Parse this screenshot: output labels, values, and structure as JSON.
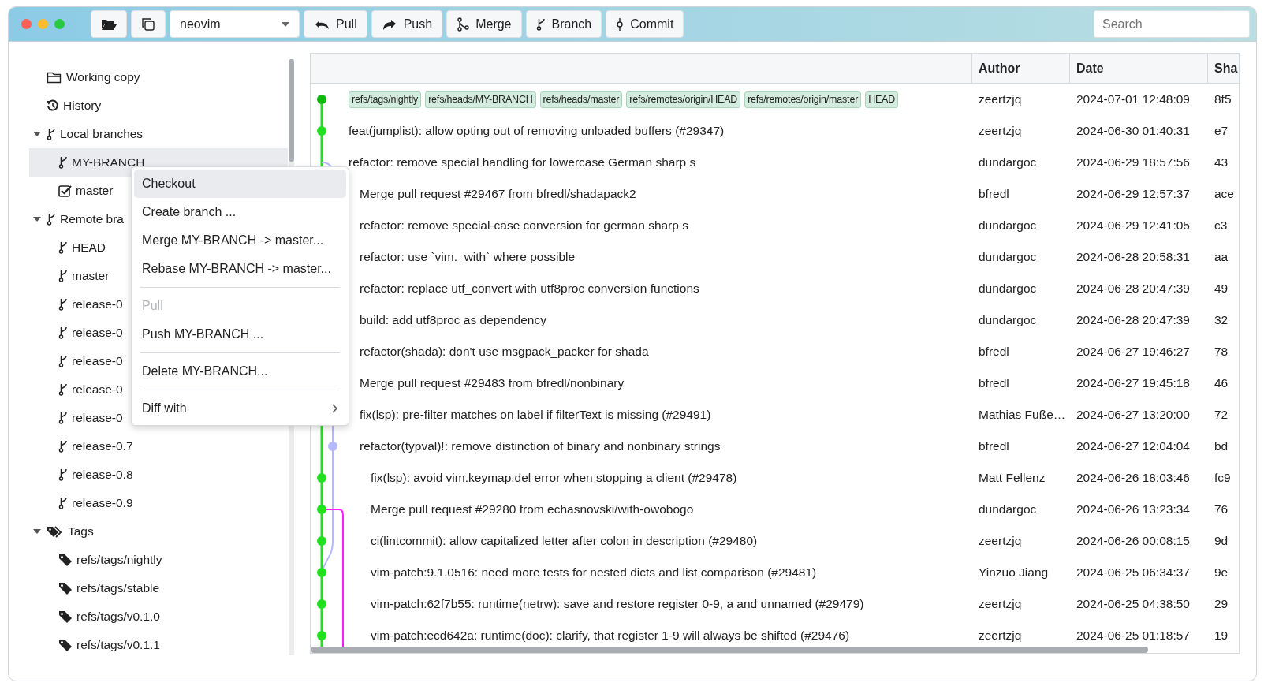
{
  "toolbar": {
    "repository": "neovim",
    "buttons": [
      {
        "label": "Pull",
        "kind": "pull"
      },
      {
        "label": "Push",
        "kind": "push"
      },
      {
        "label": "Merge",
        "kind": "merge"
      },
      {
        "label": "Branch",
        "kind": "branch"
      },
      {
        "label": "Commit",
        "kind": "commit"
      }
    ],
    "search": {
      "placeholder": "Search"
    }
  },
  "sidebar": {
    "items": [
      {
        "label": "Working copy",
        "kind": "working-copy",
        "selected": false
      },
      {
        "label": "History",
        "kind": "history",
        "selected": false
      },
      {
        "label": "Local branches",
        "kind": "branch-group",
        "expanded": true,
        "selected": false,
        "children": [
          {
            "label": "MY-BRANCH",
            "kind": "branch",
            "selected": true
          },
          {
            "label": "master",
            "kind": "current-branch",
            "selected": false
          }
        ]
      },
      {
        "label": "Remote bra",
        "kind": "branch-group",
        "expanded": true,
        "selected": false,
        "children": [
          {
            "label": "HEAD",
            "kind": "branch",
            "selected": false
          },
          {
            "label": "master",
            "kind": "branch",
            "selected": false
          },
          {
            "label": "release-0",
            "kind": "branch",
            "selected": false
          },
          {
            "label": "release-0",
            "kind": "branch",
            "selected": false
          },
          {
            "label": "release-0",
            "kind": "branch",
            "selected": false
          },
          {
            "label": "release-0",
            "kind": "branch",
            "selected": false
          },
          {
            "label": "release-0",
            "kind": "branch",
            "selected": false
          },
          {
            "label": "release-0.7",
            "kind": "branch",
            "selected": false
          },
          {
            "label": "release-0.8",
            "kind": "branch",
            "selected": false
          },
          {
            "label": "release-0.9",
            "kind": "branch",
            "selected": false
          }
        ]
      },
      {
        "label": "Tags",
        "kind": "tag-group",
        "expanded": true,
        "selected": false,
        "children": [
          {
            "label": "refs/tags/nightly",
            "kind": "tag",
            "selected": false
          },
          {
            "label": "refs/tags/stable",
            "kind": "tag",
            "selected": false
          },
          {
            "label": "refs/tags/v0.1.0",
            "kind": "tag",
            "selected": false
          },
          {
            "label": "refs/tags/v0.1.1",
            "kind": "tag",
            "selected": false
          }
        ]
      }
    ]
  },
  "context_menu": {
    "items": [
      {
        "kind": "item",
        "label": "Checkout",
        "selected": true,
        "disabled": false
      },
      {
        "kind": "item",
        "label": "Create branch ...",
        "selected": false,
        "disabled": false
      },
      {
        "kind": "item",
        "label": "Merge MY-BRANCH -> master...",
        "selected": false,
        "disabled": false
      },
      {
        "kind": "item",
        "label": "Rebase MY-BRANCH -> master...",
        "selected": false,
        "disabled": false
      },
      {
        "kind": "separator"
      },
      {
        "kind": "item",
        "label": "Pull",
        "selected": false,
        "disabled": true
      },
      {
        "kind": "item",
        "label": "Push MY-BRANCH ...",
        "selected": false,
        "disabled": false
      },
      {
        "kind": "separator"
      },
      {
        "kind": "item",
        "label": "Delete MY-BRANCH...",
        "selected": false,
        "disabled": false
      },
      {
        "kind": "separator"
      },
      {
        "kind": "submenu",
        "label": "Diff with",
        "selected": false,
        "disabled": false
      }
    ]
  },
  "commits": {
    "columns": [
      "Author",
      "Date",
      "Sha"
    ],
    "rows": [
      {
        "refs": [
          "refs/tags/nightly",
          "refs/heads/MY-BRANCH",
          "refs/heads/master",
          "refs/remotes/origin/HEAD",
          "refs/remotes/origin/master",
          "HEAD"
        ],
        "author": "zeertzjq",
        "date": "2024-07-01 12:48:09",
        "sha": "8f5"
      },
      {
        "message": "feat(jumplist): allow opting out of removing unloaded buffers (#29347)",
        "author": "zeertzjq",
        "date": "2024-06-30 01:40:31",
        "sha": "e7"
      },
      {
        "message": "refactor: remove special handling for lowercase German sharp s",
        "author": "dundargoc",
        "date": "2024-06-29 18:57:56",
        "sha": "43"
      },
      {
        "message": "Merge pull request #29467 from bfredl/shadapack2",
        "author": "bfredl",
        "date": "2024-06-29 12:57:37",
        "sha": "ace"
      },
      {
        "message": "refactor: remove special-case conversion for german sharp s",
        "author": "dundargoc",
        "date": "2024-06-29 12:41:05",
        "sha": "c3"
      },
      {
        "message": "refactor: use `vim._with` where possible",
        "author": "dundargoc",
        "date": "2024-06-28 20:58:31",
        "sha": "aa"
      },
      {
        "message": "refactor: replace utf_convert with utf8proc conversion functions",
        "author": "dundargoc",
        "date": "2024-06-28 20:47:39",
        "sha": "49"
      },
      {
        "message": "build: add utf8proc as dependency",
        "author": "dundargoc",
        "date": "2024-06-28 20:47:39",
        "sha": "32"
      },
      {
        "message": "refactor(shada): don't use msgpack_packer for shada",
        "author": "bfredl",
        "date": "2024-06-27 19:46:27",
        "sha": "78"
      },
      {
        "message": "Merge pull request #29483 from bfredl/nonbinary",
        "author": "bfredl",
        "date": "2024-06-27 19:45:18",
        "sha": "46"
      },
      {
        "message": "fix(lsp): pre-filter matches on label if filterText is missing (#29491)",
        "author": "Mathias Fuße…",
        "date": "2024-06-27 13:20:00",
        "sha": "72"
      },
      {
        "message": "refactor(typval)!: remove distinction of binary and nonbinary strings",
        "author": "bfredl",
        "date": "2024-06-27 12:04:04",
        "sha": "bd"
      },
      {
        "message": "fix(lsp): avoid vim.keymap.del error when stopping a client (#29478)",
        "author": "Matt Fellenz",
        "date": "2024-06-26 18:03:46",
        "sha": "fc9"
      },
      {
        "message": "Merge pull request #29280 from echasnovski/with-owobogo",
        "author": "dundargoc",
        "date": "2024-06-26 13:23:34",
        "sha": "76"
      },
      {
        "message": "ci(lintcommit): allow capitalized letter after colon in description (#29480)",
        "author": "zeertzjq",
        "date": "2024-06-26 00:08:15",
        "sha": "9d"
      },
      {
        "message": "vim-patch:9.1.0516: need more tests for nested dicts and list comparison (#29481)",
        "author": "Yinzuo Jiang",
        "date": "2024-06-25 06:34:37",
        "sha": "9e"
      },
      {
        "message": "vim-patch:62f7b55: runtime(netrw): save and restore register 0-9, a and unnamed (#29479)",
        "author": "zeertzjq",
        "date": "2024-06-25 04:38:50",
        "sha": "29"
      },
      {
        "message": "vim-patch:ecd642a: runtime(doc): clarify, that register 1-9 will always be shifted (#29476)",
        "author": "zeertzjq",
        "date": "2024-06-25 01:18:57",
        "sha": "19"
      }
    ]
  }
}
